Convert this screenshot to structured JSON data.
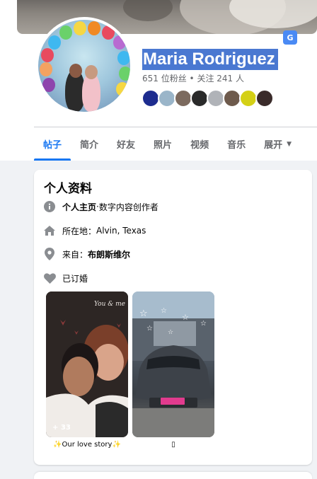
{
  "profile": {
    "name": "Maria Rodriguez",
    "followers": "651 位粉丝",
    "separator": " • ",
    "following": "关注 241 人",
    "translate_icon": "translate-icon"
  },
  "friends": [
    {
      "color": "#1d2c8f"
    },
    {
      "color": "#9ab5c9"
    },
    {
      "color": "#7c6a5e"
    },
    {
      "color": "#2a2a2a"
    },
    {
      "color": "#b0b3b8"
    },
    {
      "color": "#6e5a4c"
    },
    {
      "color": "#d4d016"
    },
    {
      "color": "#3a2b2a"
    }
  ],
  "tabs": [
    {
      "label": "帖子",
      "active": true
    },
    {
      "label": "简介"
    },
    {
      "label": "好友"
    },
    {
      "label": "照片"
    },
    {
      "label": "视频"
    },
    {
      "label": "音乐"
    },
    {
      "label": "展开"
    }
  ],
  "intro": {
    "title": "个人资料",
    "page_label": "个人主页",
    "page_sep": " · ",
    "page_category": "数字内容创作者",
    "location_label": "所在地：",
    "location_value": "Alvin, Texas",
    "from_label": "来自：",
    "from_value": "布朗斯维尔",
    "relationship": "已订婚"
  },
  "highlights": [
    {
      "label": "✨Our love story✨",
      "count": "+ 33"
    },
    {
      "label": "▯"
    }
  ],
  "colors": {
    "accent": "#1877f2",
    "name_highlight": "#4a78d1",
    "secondary_text": "#65676b"
  }
}
